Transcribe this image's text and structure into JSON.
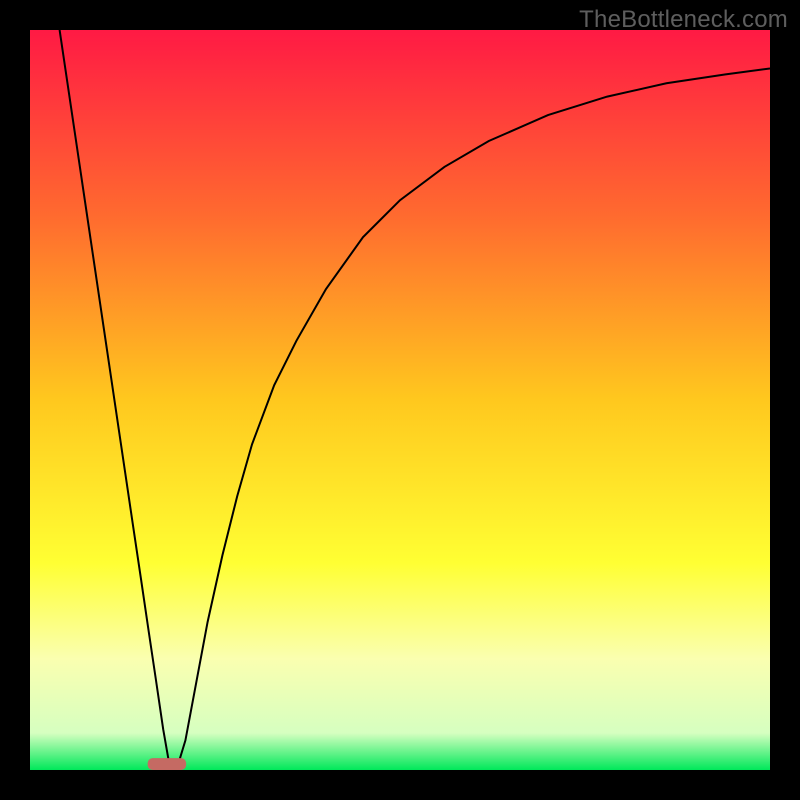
{
  "watermark": "TheBottleneck.com",
  "chart_data": {
    "type": "line",
    "title": "",
    "xlabel": "",
    "ylabel": "",
    "xlim": [
      0,
      100
    ],
    "ylim": [
      0,
      100
    ],
    "background_gradient": {
      "stops": [
        {
          "offset": 0.0,
          "color": "#ff1a44"
        },
        {
          "offset": 0.25,
          "color": "#ff6a2f"
        },
        {
          "offset": 0.5,
          "color": "#ffc81e"
        },
        {
          "offset": 0.72,
          "color": "#ffff33"
        },
        {
          "offset": 0.85,
          "color": "#faffb0"
        },
        {
          "offset": 0.95,
          "color": "#d6ffc0"
        },
        {
          "offset": 1.0,
          "color": "#00e85a"
        }
      ]
    },
    "series": [
      {
        "name": "bottleneck-curve",
        "type": "line",
        "color": "#000000",
        "x": [
          4.0,
          6.0,
          8.0,
          10.0,
          12.0,
          14.0,
          15.0,
          16.0,
          17.0,
          18.0,
          18.7,
          19.3,
          20.0,
          21.0,
          22.5,
          24.0,
          26.0,
          28.0,
          30.0,
          33.0,
          36.0,
          40.0,
          45.0,
          50.0,
          56.0,
          62.0,
          70.0,
          78.0,
          86.0,
          94.0,
          100.0
        ],
        "y": [
          100.0,
          86.5,
          73.0,
          59.5,
          46.0,
          32.5,
          25.8,
          19.0,
          12.3,
          5.5,
          1.5,
          0.5,
          0.7,
          4.0,
          12.0,
          20.0,
          29.0,
          37.0,
          44.0,
          52.0,
          58.0,
          65.0,
          72.0,
          77.0,
          81.5,
          85.0,
          88.5,
          91.0,
          92.8,
          94.0,
          94.8
        ]
      }
    ],
    "marker": {
      "name": "optimal-range",
      "color": "#c56a63",
      "shape": "rounded-rect",
      "x_center": 18.5,
      "y": 0,
      "width_pct": 5.2,
      "height_pct": 1.6
    }
  }
}
